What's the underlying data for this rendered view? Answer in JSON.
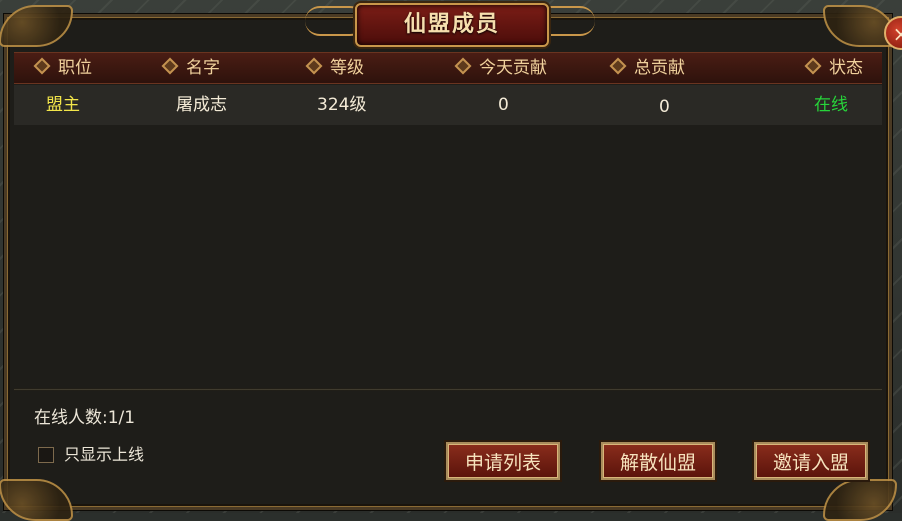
{
  "dialog": {
    "title": "仙盟成员",
    "close_symbol": "×"
  },
  "table": {
    "columns": [
      "职位",
      "名字",
      "等级",
      "今天贡献",
      "总贡献",
      "状态"
    ],
    "rows": [
      {
        "position": "盟主",
        "name": "屠成志",
        "level": "324级",
        "today_contribution": "0",
        "total_contribution": "0",
        "status": "在线"
      }
    ]
  },
  "footer": {
    "online_count": "在线人数:1/1",
    "only_online_label": "只显示上线",
    "only_online_checked": false,
    "buttons": {
      "apply_list": "申请列表",
      "disband": "解散仙盟",
      "invite": "邀请入盟"
    }
  },
  "colors": {
    "leader_text": "#f2e54a",
    "name_text": "#f3ead6",
    "value_text": "#f3ead6",
    "online_status": "#27d43a",
    "header_text": "#f0d19c"
  }
}
